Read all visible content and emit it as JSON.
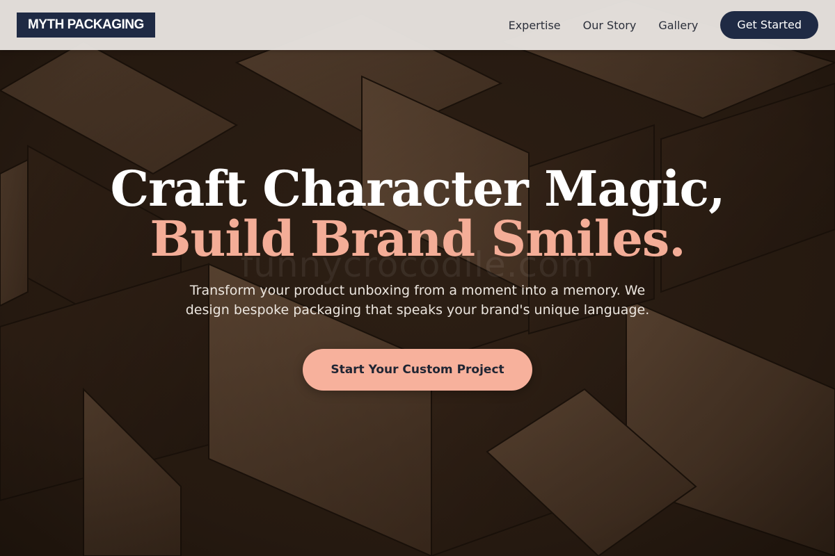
{
  "navbar": {
    "logo": "MYTH PACKAGING",
    "links": [
      "Expertise",
      "Our Story",
      "Gallery"
    ],
    "cta": "Get Started"
  },
  "hero": {
    "title_line1": "Craft Character Magic,",
    "title_line2": "Build Brand Smiles.",
    "subtitle": "Transform your product unboxing from a moment into a memory. We design bespoke packaging that speaks your brand's unique language.",
    "cta": "Start Your Custom Project",
    "watermark": "funnycrocodile.com"
  },
  "colors": {
    "navy": "#1f2a44",
    "accent": "#f4ad97",
    "navbar_bg": "#e6e2de",
    "hero_bg": "#2a1e15"
  }
}
